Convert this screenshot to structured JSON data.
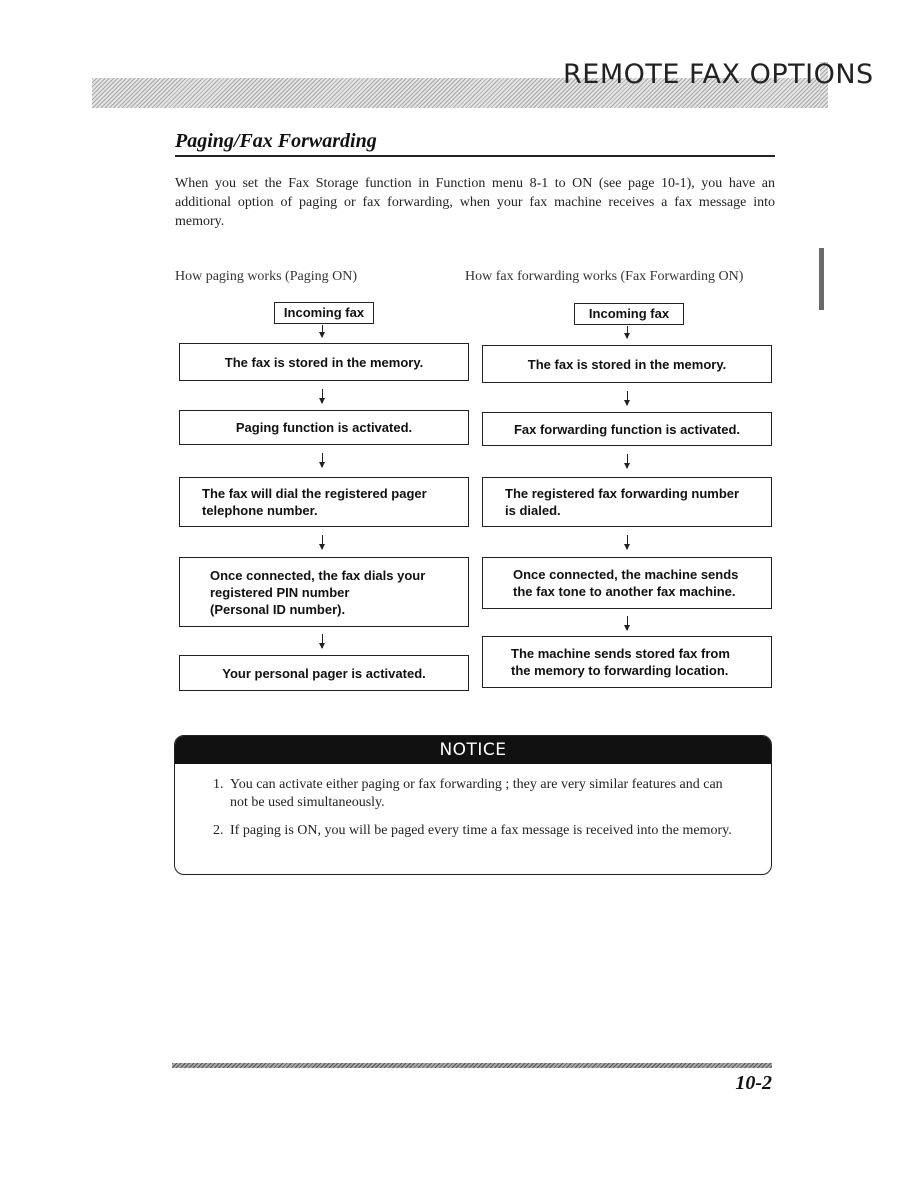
{
  "header": {
    "title": "REMOTE FAX OPTIONS"
  },
  "section": {
    "title": "Paging/Fax Forwarding",
    "intro": "When you set the Fax Storage function in Function menu 8-1 to ON (see page 10-1), you have an additional option of paging or fax forwarding, when your fax machine receives a fax message into memory."
  },
  "paging": {
    "heading": "How paging works (Paging ON)",
    "start": "Incoming fax",
    "steps": [
      "The fax is stored in the memory.",
      "Paging function is activated.",
      "The fax will dial the registered pager\ntelephone number.",
      "Once connected, the fax dials your\nregistered PIN number\n(Personal ID number).",
      "Your personal pager is activated."
    ]
  },
  "forwarding": {
    "heading": "How fax forwarding works (Fax Forwarding ON)",
    "start": "Incoming fax",
    "steps": [
      "The fax is stored in the memory.",
      "Fax forwarding function is activated.",
      "The registered fax forwarding number\nis dialed.",
      "Once connected, the machine sends\nthe fax tone to another fax machine.",
      "The machine sends stored fax from\nthe memory to forwarding location."
    ]
  },
  "notice": {
    "title": "NOTICE",
    "items": [
      {
        "num": "1.",
        "text": "You can activate either paging or fax forwarding ; they are very similar features and can not be used simultaneously."
      },
      {
        "num": "2.",
        "text": "If paging is ON, you will be paged every time a fax message is received into the memory."
      }
    ]
  },
  "footer": {
    "page_number": "10-2"
  }
}
